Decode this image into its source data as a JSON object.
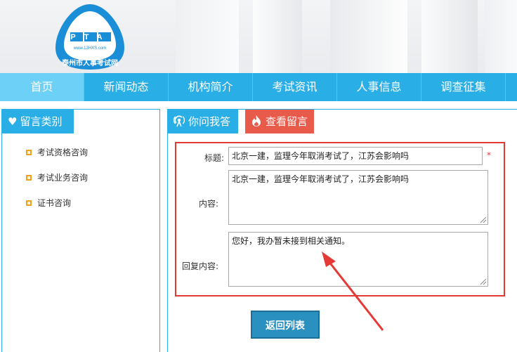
{
  "header": {
    "logo_acronym": "PTA",
    "logo_url_text": "www.12HXS.com",
    "logo_name": "泰州市人事考试网"
  },
  "nav": {
    "items": [
      {
        "label": "首页",
        "active": true
      },
      {
        "label": "新闻动态"
      },
      {
        "label": "机构简介"
      },
      {
        "label": "考试资讯"
      },
      {
        "label": "人事信息"
      },
      {
        "label": "调查征集"
      }
    ]
  },
  "sidebar": {
    "title": "留言类别",
    "items": [
      "考试资格咨询",
      "考试业务咨询",
      "证书咨询"
    ]
  },
  "main": {
    "tabs": {
      "ask": "你问我答",
      "view": "查看留言"
    },
    "form": {
      "title_label": "标题:",
      "title_value": "北京一建，监理今年取消考试了，江苏会影响吗",
      "required_mark": "*",
      "content_label": "内容:",
      "content_value": "北京一建，监理今年取消考试了，江苏会影响吗",
      "reply_label": "回复内容:",
      "reply_value": "您好，我办暂未接到相关通知。"
    },
    "back_button": "返回列表"
  },
  "colors": {
    "nav_bg": "#2aaee6",
    "nav_active": "#6cd0f7",
    "highlight_box": "#e53935",
    "tab_view": "#e85a4a",
    "button_bg": "#2a90c0"
  }
}
